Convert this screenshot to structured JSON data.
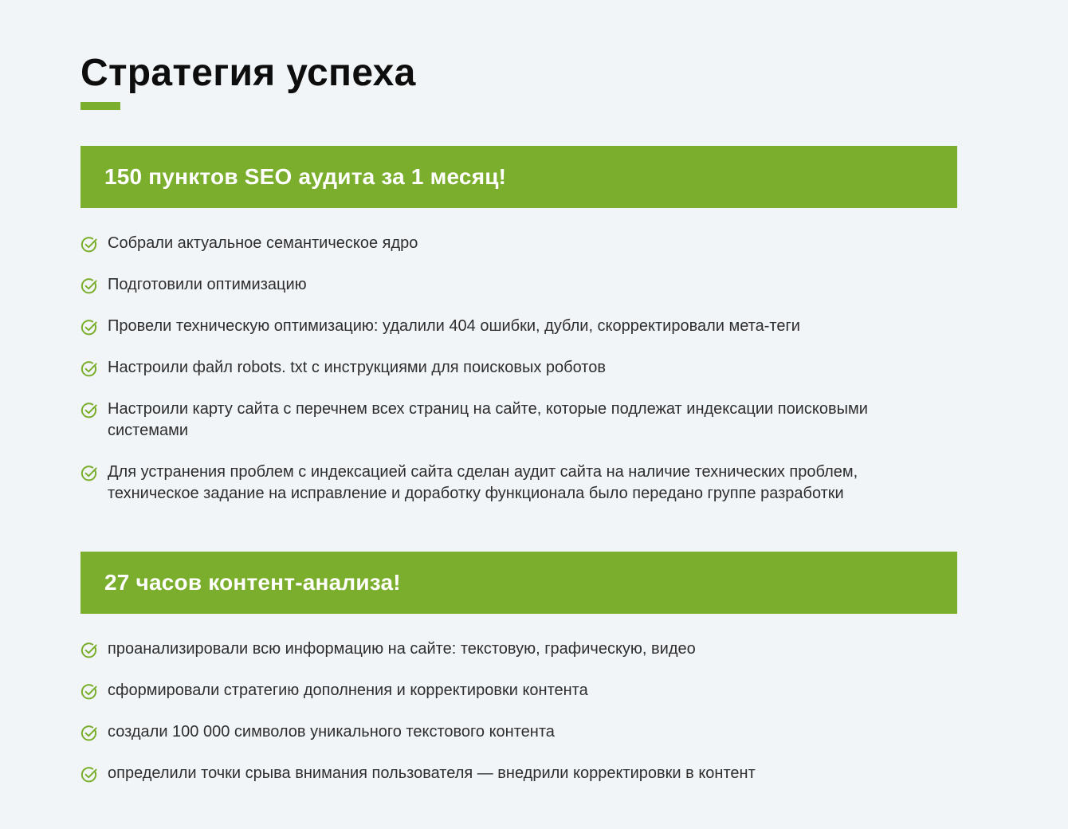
{
  "page": {
    "title": "Стратегия успеха"
  },
  "colors": {
    "accent": "#7aae2c",
    "background": "#f2f5f8",
    "text": "#2e2e2e",
    "heading": "#0d0d0d"
  },
  "sections": [
    {
      "title": "150 пунктов SEO аудита за 1 месяц!",
      "items": [
        {
          "icon": "check-circle-icon",
          "text": "Собрали актуальное семантическое ядро"
        },
        {
          "icon": "check-circle-icon",
          "text": "Подготовили оптимизацию"
        },
        {
          "icon": "check-circle-icon",
          "text": "Провели техническую оптимизацию: удалили 404 ошибки, дубли, скорректировали мета-теги"
        },
        {
          "icon": "check-circle-icon",
          "text": "Настроили файл robots. txt с инструкциями для поисковых роботов"
        },
        {
          "icon": "check-circle-icon",
          "text": "Настроили карту сайта с перечнем всех страниц на сайте, которые подлежат индексации поисковыми системами"
        },
        {
          "icon": "check-circle-icon",
          "text": "Для устранения проблем с индексацией сайта сделан аудит сайта на наличие технических проблем, техническое задание на исправление и доработку функционала было передано группе разработки"
        }
      ]
    },
    {
      "title": "27 часов контент-анализа!",
      "items": [
        {
          "icon": "check-circle-icon",
          "text": "проанализировали всю информацию на сайте: текстовую, графическую, видео"
        },
        {
          "icon": "check-circle-icon",
          "text": "сформировали стратегию дополнения и корректировки контента"
        },
        {
          "icon": "check-circle-icon",
          "text": "создали 100 000 символов уникального текстового контента"
        },
        {
          "icon": "check-circle-icon",
          "text": "определили точки срыва внимания пользователя — внедрили корректировки в контент"
        }
      ]
    }
  ]
}
